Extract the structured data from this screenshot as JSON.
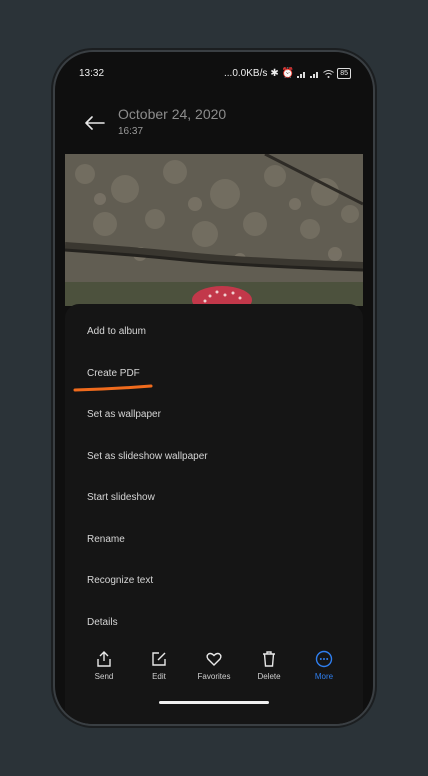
{
  "status": {
    "time": "13:32",
    "network": "...0.0KB/s",
    "battery": "85"
  },
  "header": {
    "title": "October 24, 2020",
    "time": "16:37"
  },
  "menu": {
    "items": [
      {
        "label": "Add to album"
      },
      {
        "label": "Create PDF"
      },
      {
        "label": "Set as wallpaper"
      },
      {
        "label": "Set as slideshow wallpaper"
      },
      {
        "label": "Start slideshow"
      },
      {
        "label": "Rename"
      },
      {
        "label": "Recognize text"
      },
      {
        "label": "Details"
      }
    ],
    "highlight_color": "#f06b1d"
  },
  "toolbar": {
    "items": [
      {
        "label": "Send",
        "icon": "share-icon"
      },
      {
        "label": "Edit",
        "icon": "edit-icon"
      },
      {
        "label": "Favorites",
        "icon": "heart-icon"
      },
      {
        "label": "Delete",
        "icon": "trash-icon"
      },
      {
        "label": "More",
        "icon": "more-icon",
        "active": true
      }
    ],
    "active_color": "#2f7ff0"
  }
}
